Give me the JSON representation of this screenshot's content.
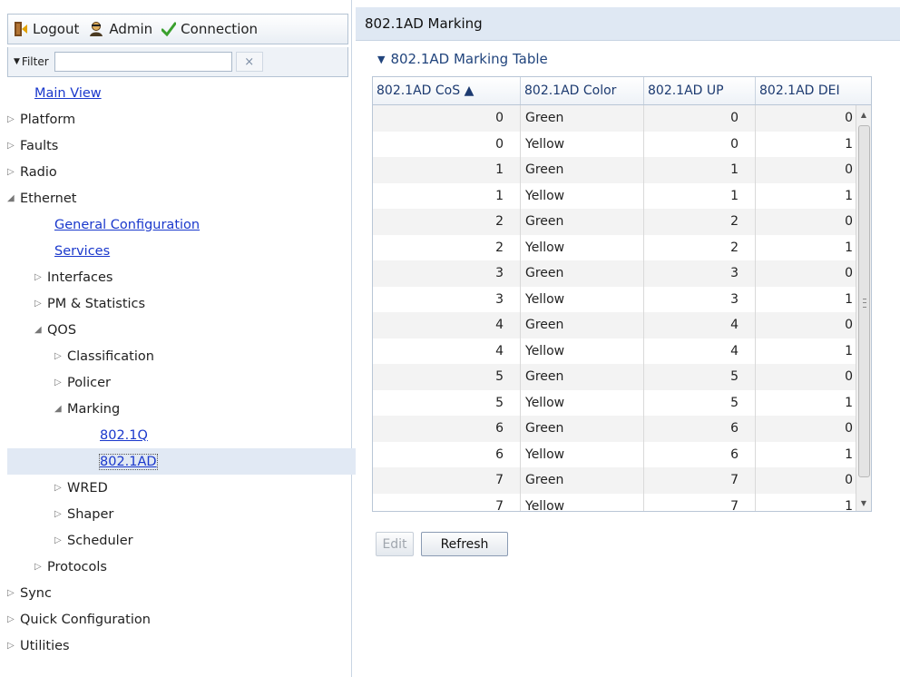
{
  "toolbar": {
    "logout_label": "Logout",
    "admin_label": "Admin",
    "connection_label": "Connection"
  },
  "filter": {
    "label": "Filter",
    "value": "",
    "clear_icon": "×"
  },
  "tree": {
    "main_view": "Main View",
    "platform": "Platform",
    "faults": "Faults",
    "radio": "Radio",
    "ethernet": "Ethernet",
    "general_configuration": "General Configuration",
    "services": "Services",
    "interfaces": "Interfaces",
    "pm_statistics": "PM & Statistics",
    "qos": "QOS",
    "classification": "Classification",
    "policer": "Policer",
    "marking": "Marking",
    "m_8021q": "802.1Q",
    "m_8021ad": "802.1AD",
    "wred": "WRED",
    "shaper": "Shaper",
    "scheduler": "Scheduler",
    "protocols": "Protocols",
    "sync": "Sync",
    "quick_configuration": "Quick Configuration",
    "utilities": "Utilities"
  },
  "page": {
    "title": "802.1AD Marking",
    "section_title": "802.1AD Marking Table"
  },
  "table": {
    "headers": [
      "802.1AD CoS ▲",
      "802.1AD Color",
      "802.1AD UP",
      "802.1AD DEI"
    ],
    "rows": [
      [
        "0",
        "Green",
        "0",
        "0"
      ],
      [
        "0",
        "Yellow",
        "0",
        "1"
      ],
      [
        "1",
        "Green",
        "1",
        "0"
      ],
      [
        "1",
        "Yellow",
        "1",
        "1"
      ],
      [
        "2",
        "Green",
        "2",
        "0"
      ],
      [
        "2",
        "Yellow",
        "2",
        "1"
      ],
      [
        "3",
        "Green",
        "3",
        "0"
      ],
      [
        "3",
        "Yellow",
        "3",
        "1"
      ],
      [
        "4",
        "Green",
        "4",
        "0"
      ],
      [
        "4",
        "Yellow",
        "4",
        "1"
      ],
      [
        "5",
        "Green",
        "5",
        "0"
      ],
      [
        "5",
        "Yellow",
        "5",
        "1"
      ],
      [
        "6",
        "Green",
        "6",
        "0"
      ],
      [
        "6",
        "Yellow",
        "6",
        "1"
      ],
      [
        "7",
        "Green",
        "7",
        "0"
      ],
      [
        "7",
        "Yellow",
        "7",
        "1"
      ]
    ]
  },
  "actions": {
    "edit_label": "Edit",
    "refresh_label": "Refresh"
  },
  "colors": {
    "link": "#1a38cc",
    "header_bg": "#dfe8f3",
    "section_title": "#22457d",
    "check_green": "#3aa02d"
  },
  "icons": {
    "logout": "logout-door-icon",
    "admin": "admin-user-icon",
    "connection": "checkmark-icon",
    "filter": "filter-triangle-icon"
  }
}
